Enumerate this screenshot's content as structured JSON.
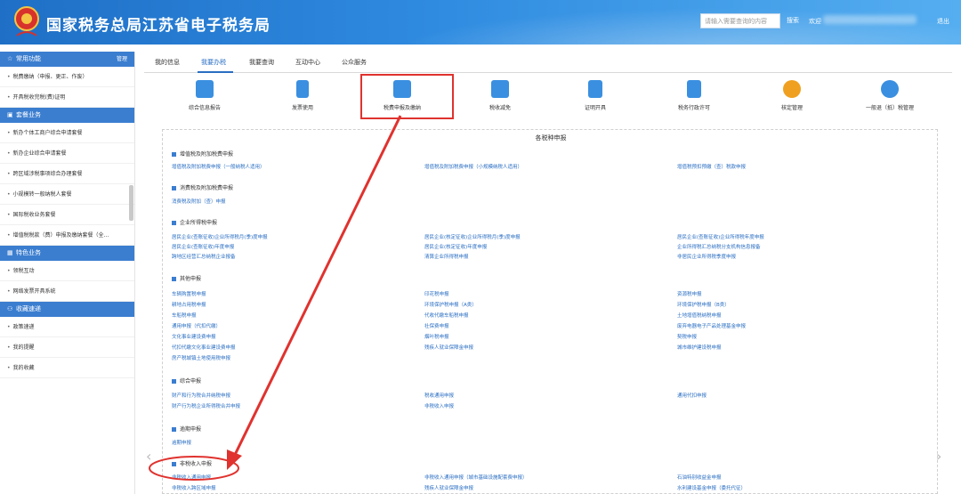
{
  "header": {
    "title": "国家税务总局江苏省电子税务局",
    "search_placeholder": "请输入需要查询的内容",
    "search_label": "搜索",
    "welcome": "欢迎",
    "logout": "退出"
  },
  "sidebar": {
    "sections": [
      {
        "title": "常用功能",
        "manage": "管理",
        "items": [
          "税费缴纳（申报、更正、作废）",
          "开具税收完税(费)证明"
        ]
      },
      {
        "title": "套餐业务",
        "items": [
          "新办个体工商户综合申请套餐",
          "新办企业综合申请套餐",
          "跨区域涉税事项综合办理套餐",
          "小规模转一般纳税人套餐",
          "国际税收业务套餐",
          "增值税税款（费）申报及缴纳套餐（全..."
        ]
      },
      {
        "title": "特色业务",
        "items": [
          "领税互动",
          "网络发票开具系统"
        ]
      },
      {
        "title": "收藏速递",
        "items": [
          "政策速递",
          "我的提醒",
          "我的收藏"
        ]
      }
    ]
  },
  "tabs": [
    "我的信息",
    "我要办税",
    "我要查询",
    "互动中心",
    "公众服务"
  ],
  "functions": [
    {
      "label": "综合信息报告",
      "icon": "report-icon",
      "color": "#3a8fe0"
    },
    {
      "label": "发票使用",
      "icon": "invoice-icon",
      "color": "#3a8fe0"
    },
    {
      "label": "税费申报及缴纳",
      "icon": "monitor-icon",
      "color": "#3a8fe0"
    },
    {
      "label": "税收减免",
      "icon": "chart-icon",
      "color": "#3a8fe0"
    },
    {
      "label": "证明开具",
      "icon": "certificate-icon",
      "color": "#3a8fe0"
    },
    {
      "label": "税务行政许可",
      "icon": "license-icon",
      "color": "#3a8fe0"
    },
    {
      "label": "核定管理",
      "icon": "shield-icon",
      "color": "#f0a020"
    },
    {
      "label": "一般退（抵）税管理",
      "icon": "network-icon",
      "color": "#3a8fe0"
    }
  ],
  "panel": {
    "title": "各税种申报",
    "groups": [
      {
        "title": "增值税及附加税费申报",
        "links": [
          "增值税及附加税费申报（一般纳税人适用）",
          "增值税及附加税费申报（小规模纳税人适用）",
          "增值税预扣预缴（查）税款申报"
        ]
      },
      {
        "title": "消费税及附加税费申报",
        "links": [
          "消费税及附加（查）申报"
        ]
      },
      {
        "title": "企业所得税申报",
        "links": [
          "居民企业(查账征收)企业所得税月(季)度申报",
          "居民企业(核定征收)企业所得税月(季)度申报",
          "居民企业(查账征收)企业所得税年度申报",
          "居民企业(查账征收)年度申报",
          "居民企业(核定征收)年度申报",
          "企业所得税汇总纳税分支机构信息报备",
          "跨地区经营汇总纳税企业报备",
          "清算企业所得税申报",
          "非居民企业所得税季度申报"
        ]
      },
      {
        "title": "其他申报",
        "links": [
          "车辆购置税申报",
          "印花税申报",
          "资源税申报",
          "耕地占用税申报",
          "环境保护税申报（A类）",
          "环境保护税申报（B类）",
          "车船税申报",
          "代收代缴车船税申报",
          "土地增值税纳税申报",
          "通用申报（代扣代缴）",
          "社保费申报",
          "废弃电器电子产品处理基金申报",
          "文化事业建设费申报",
          "烟叶税申报",
          "契税申报",
          "代扣代缴文化事业建设费申报",
          "残疾人就业保障金申报",
          "城市维护建设税申报",
          "房产税城镇土地使用税申报"
        ]
      },
      {
        "title": "综合申报",
        "links": [
          "财产和行为税合并纳税申报",
          "税收通用申报",
          "通用代扣申报",
          "财产行为税企业所得税合并申报",
          "非税收入申报"
        ]
      },
      {
        "title": "逾期申报",
        "links": [
          "逾期申报"
        ]
      },
      {
        "title": "非税收入申报",
        "links": [
          "非税收入通用申报",
          "非税收入通用申报（城市基础设施配套费申报）",
          "石油特别收益金申报",
          "非税收入跨区域申报",
          "残疾人就业保障金申报",
          "水利建设基金申报（委托代征）"
        ]
      }
    ]
  }
}
